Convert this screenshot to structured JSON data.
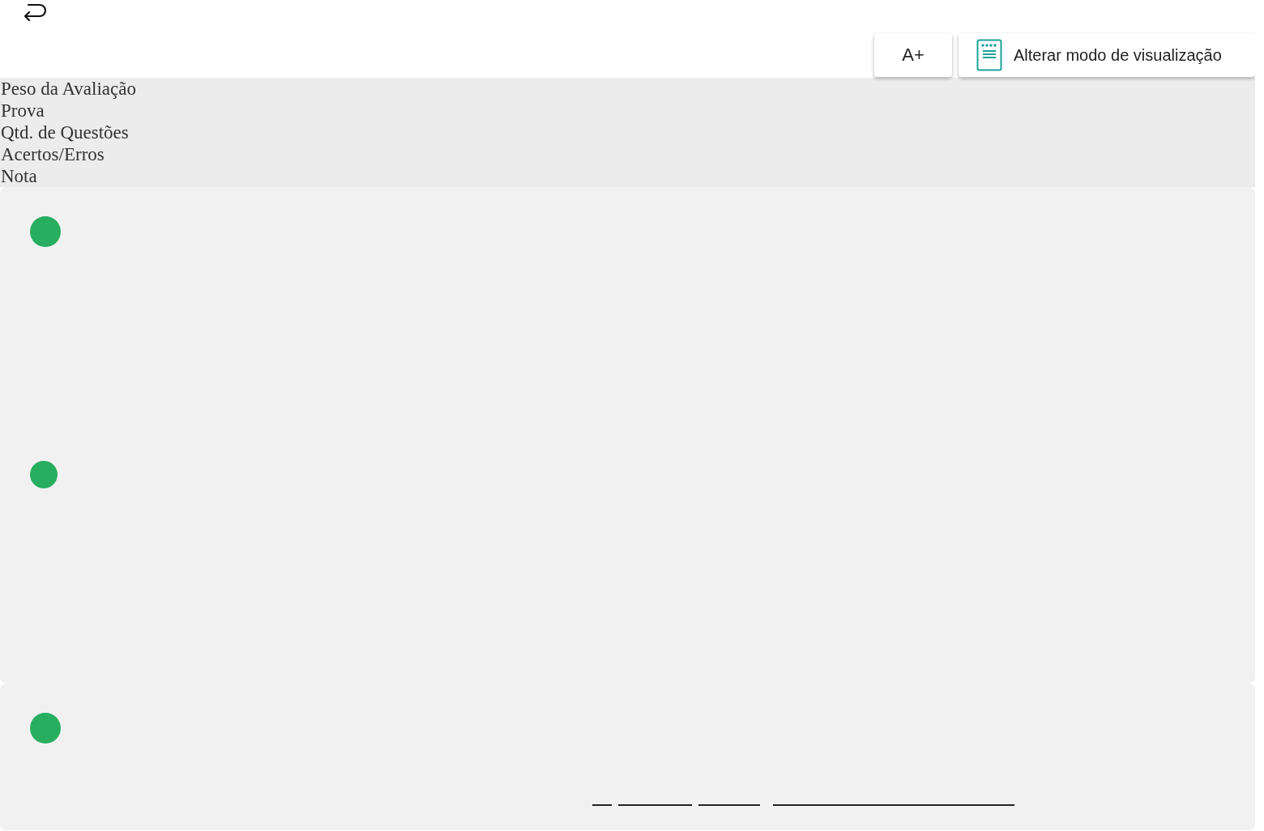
{
  "toolbar": {
    "font_button": "A+",
    "view_button": "Alterar modo de visualização"
  },
  "header_labels": [
    "Peso da Avaliação",
    "Prova",
    "Qtd. de Questões",
    "Acertos/Erros",
    "Nota"
  ]
}
